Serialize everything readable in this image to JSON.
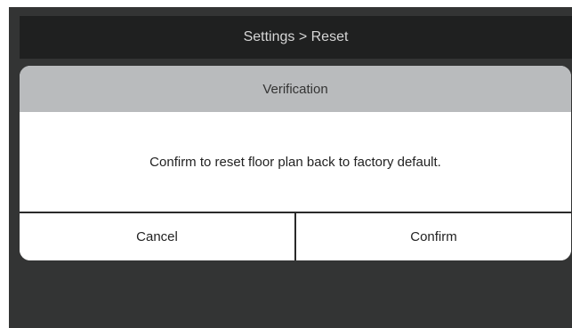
{
  "header": {
    "title": "Settings > Reset"
  },
  "dialog": {
    "title": "Verification",
    "message": "Confirm to reset floor plan back to factory default.",
    "cancel_label": "Cancel",
    "confirm_label": "Confirm"
  },
  "colors": {
    "background": "#333434",
    "titlebar": "#1f2020",
    "dialog_header": "#b9bbbd"
  }
}
